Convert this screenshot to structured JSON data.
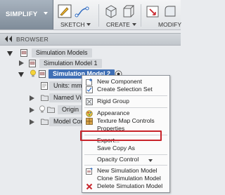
{
  "toolbar": {
    "workspace_label": "SIMPLIFY",
    "sketch_label": "SKETCH",
    "create_label": "CREATE",
    "modify_label": "MODIFY"
  },
  "browser": {
    "title": "BROWSER",
    "root": "Simulation Models",
    "model1": "Simulation Model 1",
    "model2": "Simulation Model 2",
    "units": "Units: mm",
    "named_views": "Named View",
    "origin": "Origin",
    "model_components": "Model Comp"
  },
  "context_menu": {
    "items": [
      "New Component",
      "Create Selection Set",
      "Rigid Group",
      "Appearance",
      "Texture Map Controls",
      "Properties",
      "Export...",
      "Save Copy As",
      "Opacity Control",
      "New Simulation Model",
      "Clone Simulation Model",
      "Delete Simulation Model"
    ]
  },
  "colors": {
    "selection": "#3f6fb5",
    "highlight_border": "#c8242b",
    "accent_blue": "#2f6bc1"
  }
}
